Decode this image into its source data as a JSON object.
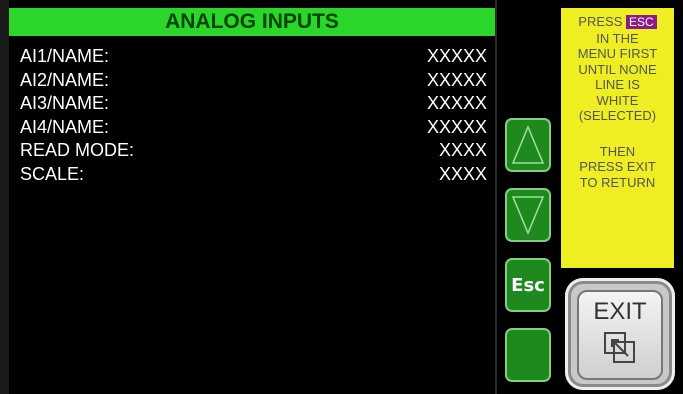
{
  "header": {
    "title": "ANALOG INPUTS"
  },
  "rows": [
    {
      "label": "AI1/NAME:",
      "value": "XXXXX"
    },
    {
      "label": "AI2/NAME:",
      "value": "XXXXX"
    },
    {
      "label": "AI3/NAME:",
      "value": "XXXXX"
    },
    {
      "label": "AI4/NAME:",
      "value": "XXXXX"
    },
    {
      "label": "READ MODE:",
      "value": "XXXX"
    },
    {
      "label": "SCALE:",
      "value": "XXXX"
    }
  ],
  "nav": {
    "up_icon": "triangle-up-icon",
    "down_icon": "triangle-down-icon",
    "esc_label": "Esc",
    "blank_icon": "blank-button"
  },
  "help": {
    "press": "PRESS",
    "esc_badge": "ESC",
    "lines": [
      "IN THE",
      "MENU FIRST",
      "UNTIL NONE",
      "LINE IS",
      "WHITE",
      "(SELECTED)"
    ],
    "lines2": [
      "THEN",
      "PRESS EXIT",
      "TO RETURN"
    ]
  },
  "exit": {
    "label": "EXIT",
    "icon": "window-exit-icon"
  },
  "colors": {
    "title_bg": "#2bd62b",
    "nav_btn": "#1e8a1e",
    "help_bg": "#eeee22",
    "esc_badge": "#8a1c8a"
  }
}
